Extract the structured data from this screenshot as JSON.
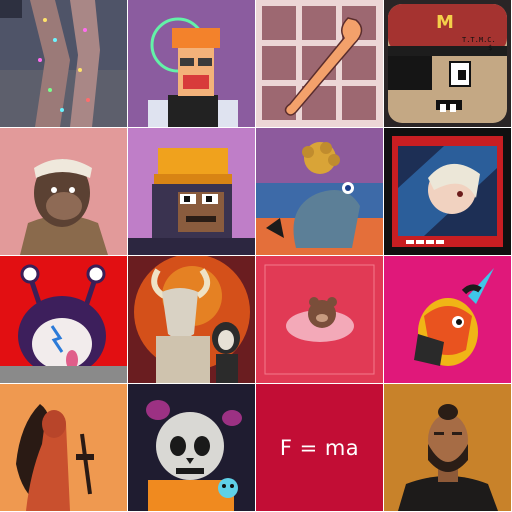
{
  "grid": {
    "rows": 4,
    "columns": 4
  },
  "tiles": [
    {
      "id": 1,
      "subject": "glitter-legs-photo",
      "bg": "#4a4f63"
    },
    {
      "id": 2,
      "subject": "pixel-punk-girl",
      "bg": "#8a5aa0"
    },
    {
      "id": 3,
      "subject": "spork-on-engraving",
      "bg": "#e7d0d0"
    },
    {
      "id": 4,
      "subject": "tmc-cap-face",
      "bg": "#2a2526",
      "cap_letter": "M",
      "cap_text": "T.T.M.C.",
      "cap_symbol": "$"
    },
    {
      "id": 5,
      "subject": "bandana-ape",
      "bg": "#e29a9a"
    },
    {
      "id": 6,
      "subject": "pixel-ape-beanie",
      "bg": "#bf7ec8"
    },
    {
      "id": 7,
      "subject": "surreal-sock-creature",
      "bg": "#5b6aa6"
    },
    {
      "id": 8,
      "subject": "anime-card",
      "bg": "#101010"
    },
    {
      "id": 9,
      "subject": "purple-creature-bolt",
      "bg": "#e20f12"
    },
    {
      "id": 10,
      "subject": "goat-and-dog",
      "bg": "#d4501a"
    },
    {
      "id": 11,
      "subject": "pink-bear-sleeping",
      "bg": "#e13a55"
    },
    {
      "id": 12,
      "subject": "unicorn-fish",
      "bg": "#e0187a"
    },
    {
      "id": 13,
      "subject": "long-hair-figure",
      "bg": "#ef9950"
    },
    {
      "id": 14,
      "subject": "skull-kid",
      "bg": "#1f1c30"
    },
    {
      "id": 15,
      "subject": "formula",
      "bg": "#c20d35",
      "formula": "F = ma"
    },
    {
      "id": 16,
      "subject": "bearded-man",
      "bg": "#c8822a"
    }
  ]
}
